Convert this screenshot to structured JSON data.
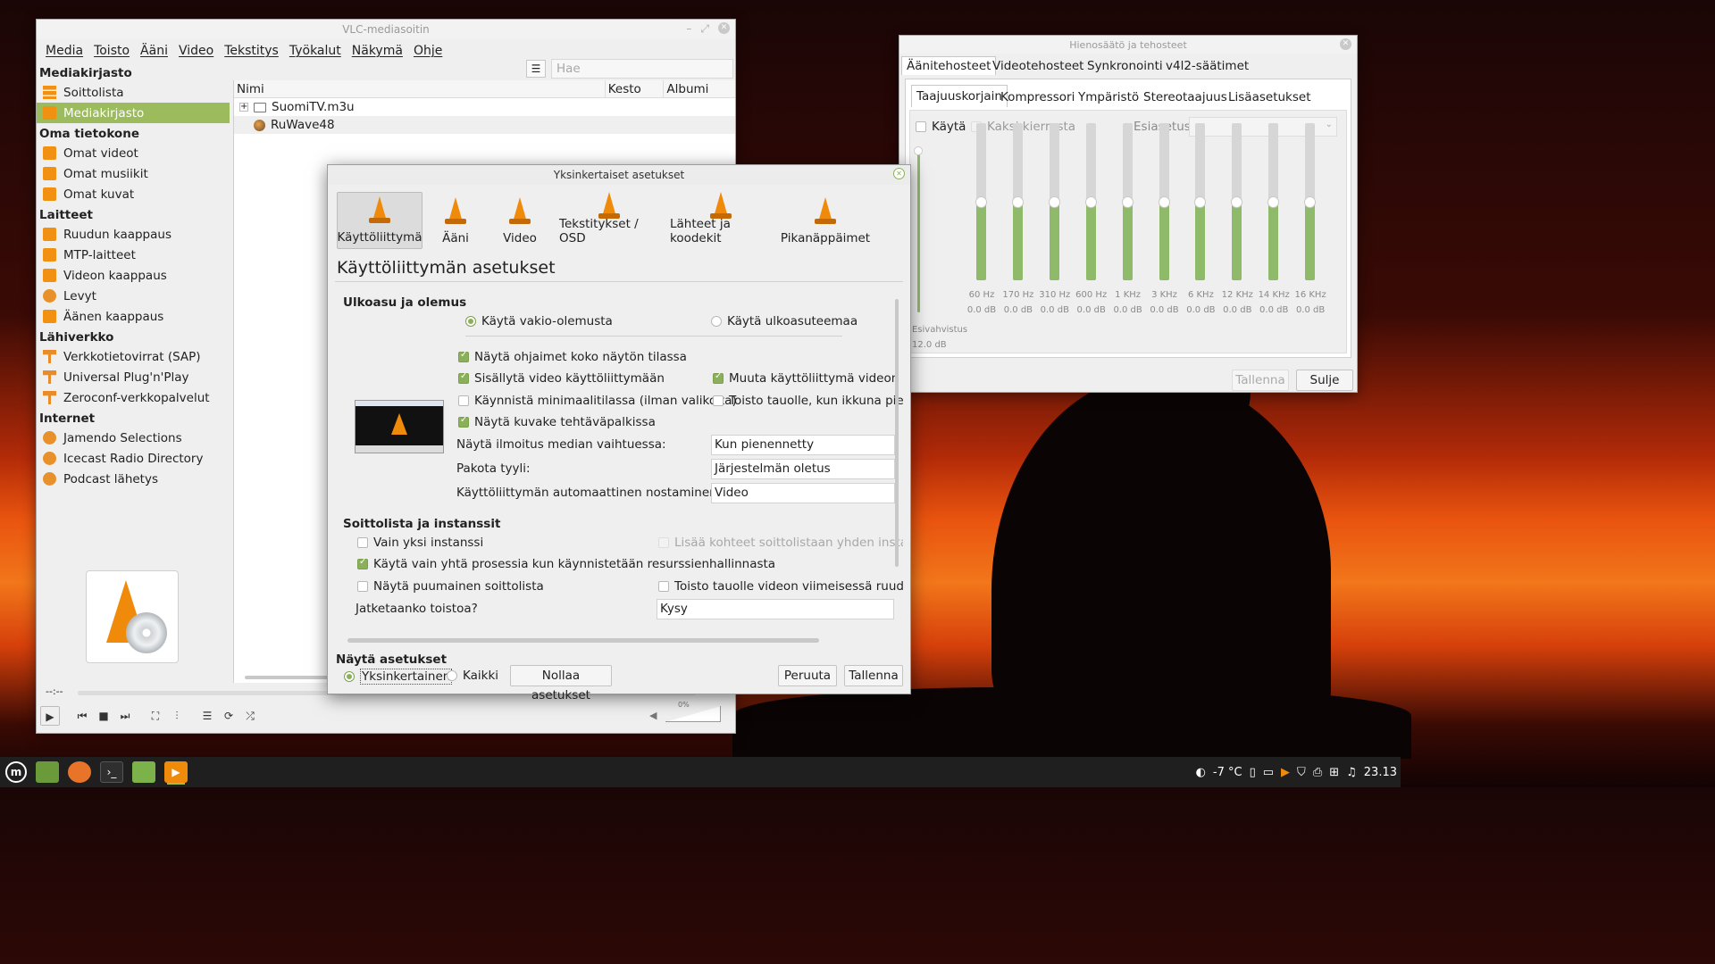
{
  "vlc": {
    "title": "VLC-mediasoitin",
    "menu": [
      "Media",
      "Toisto",
      "Ääni",
      "Video",
      "Tekstitys",
      "Työkalut",
      "Näkymä",
      "Ohje"
    ],
    "search_placeholder": "Hae",
    "sidebar": [
      {
        "type": "header",
        "label": "Mediakirjasto"
      },
      {
        "type": "item",
        "label": "Soittolista",
        "icon": "playlist-icon"
      },
      {
        "type": "item",
        "label": "Mediakirjasto",
        "icon": "library-icon",
        "selected": true
      },
      {
        "type": "header",
        "label": "Oma tietokone"
      },
      {
        "type": "item",
        "label": "Omat videot",
        "icon": "video-icon"
      },
      {
        "type": "item",
        "label": "Omat musiikit",
        "icon": "music-icon"
      },
      {
        "type": "item",
        "label": "Omat kuvat",
        "icon": "picture-icon"
      },
      {
        "type": "header",
        "label": "Laitteet"
      },
      {
        "type": "item",
        "label": "Ruudun kaappaus",
        "icon": "screen-icon"
      },
      {
        "type": "item",
        "label": "MTP-laitteet",
        "icon": "mtp-icon"
      },
      {
        "type": "item",
        "label": "Videon kaappaus",
        "icon": "capture-icon"
      },
      {
        "type": "item",
        "label": "Levyt",
        "icon": "disc-icon"
      },
      {
        "type": "item",
        "label": "Äänen kaappaus",
        "icon": "audio-capture-icon"
      },
      {
        "type": "header",
        "label": "Lähiverkko"
      },
      {
        "type": "item",
        "label": "Verkkotietovirrat (SAP)",
        "icon": "network-icon"
      },
      {
        "type": "item",
        "label": "Universal Plug'n'Play",
        "icon": "network-icon"
      },
      {
        "type": "item",
        "label": "Zeroconf-verkkopalvelut",
        "icon": "network-icon"
      },
      {
        "type": "header",
        "label": "Internet"
      },
      {
        "type": "item",
        "label": "Jamendo Selections",
        "icon": "jamendo-icon"
      },
      {
        "type": "item",
        "label": "Icecast Radio Directory",
        "icon": "radio-icon"
      },
      {
        "type": "item",
        "label": "Podcast lähetys",
        "icon": "podcast-icon"
      }
    ],
    "columns": [
      "Nimi",
      "Kesto",
      "Albumi"
    ],
    "rows": [
      {
        "name": "SuomiTV.m3u",
        "icon": "folder-icon",
        "expand": "+"
      },
      {
        "name": "RuWave48",
        "icon": "globe-icon"
      }
    ],
    "time_left": "--:--",
    "time_right": "--:--",
    "volume": "0%"
  },
  "prefs": {
    "title": "Yksinkertaiset asetukset",
    "categories": [
      "Käyttöliittymä",
      "Ääni",
      "Video",
      "Tekstitykset / OSD",
      "Lähteet ja koodekit",
      "Pikanäppäimet"
    ],
    "heading": "Käyttöliittymän asetukset",
    "appearance": {
      "title": "Ulkoasu ja olemus",
      "native": "Käytä vakio-olemusta",
      "skin": "Käytä ulkoasuteemaa"
    },
    "checks": {
      "fullscreen_controls": "Näytä ohjaimet koko näytön tilassa",
      "embed_video": "Sisällytä video käyttöliittymään",
      "resize": "Muuta käyttöliittymä videon ko",
      "minimal": "Käynnistä minimaalitilassa (ilman valikoita)",
      "pause_min": "Toisto tauolle, kun ikkuna piene",
      "systray": "Näytä kuvake tehtäväpalkissa"
    },
    "fields": {
      "notify_label": "Näytä ilmoitus median vaihtuessa:",
      "notify_value": "Kun pienennetty",
      "style_label": "Pakota tyyli:",
      "style_value": "Järjestelmän oletus",
      "raise_label": "Käyttöliittymän automaattinen nostaminen:",
      "raise_value": "Video"
    },
    "playlist": {
      "title": "Soittolista ja instanssit",
      "one_instance": "Vain yksi instanssi",
      "enqueue": "Lisää kohteet soittolistaan yhden instanss",
      "one_process": "Käytä vain yhtä prosessia kun käynnistetään resurssienhallinnasta",
      "tree": "Näytä puumainen soittolista",
      "pause_last": "Toisto tauolle videon viimeisessä ruudussa",
      "resume_label": "Jatketaanko toistoa?",
      "resume_value": "Kysy"
    },
    "show_settings": "Näytä asetukset",
    "simple": "Yksinkertainen",
    "all": "Kaikki",
    "reset": "Nollaa asetukset",
    "cancel": "Peruuta",
    "save": "Tallenna"
  },
  "eq": {
    "title": "Hienosäätö ja tehosteet",
    "tabs": [
      "Äänitehosteet",
      "Videotehosteet",
      "Synkronointi",
      "v4l2-säätimet"
    ],
    "subtabs": [
      "Taajuuskorjain",
      "Kompressori",
      "Ympäristö",
      "Stereotaajuus",
      "Lisäasetukset"
    ],
    "enable": "Käytä",
    "two_pass": "Kaksi kierrosta",
    "preset": "Esiasetus",
    "preamp_label": "Esivahvistus",
    "preamp_value": "12.0 dB",
    "bands": [
      {
        "f": "60 Hz",
        "v": "0.0 dB"
      },
      {
        "f": "170 Hz",
        "v": "0.0 dB"
      },
      {
        "f": "310 Hz",
        "v": "0.0 dB"
      },
      {
        "f": "600 Hz",
        "v": "0.0 dB"
      },
      {
        "f": "1 KHz",
        "v": "0.0 dB"
      },
      {
        "f": "3 KHz",
        "v": "0.0 dB"
      },
      {
        "f": "6 KHz",
        "v": "0.0 dB"
      },
      {
        "f": "12 KHz",
        "v": "0.0 dB"
      },
      {
        "f": "14 KHz",
        "v": "0.0 dB"
      },
      {
        "f": "16 KHz",
        "v": "0.0 dB"
      }
    ],
    "save": "Tallenna",
    "close": "Sulje"
  },
  "tray": {
    "weather": "-7 °C",
    "clock": "23.13"
  }
}
